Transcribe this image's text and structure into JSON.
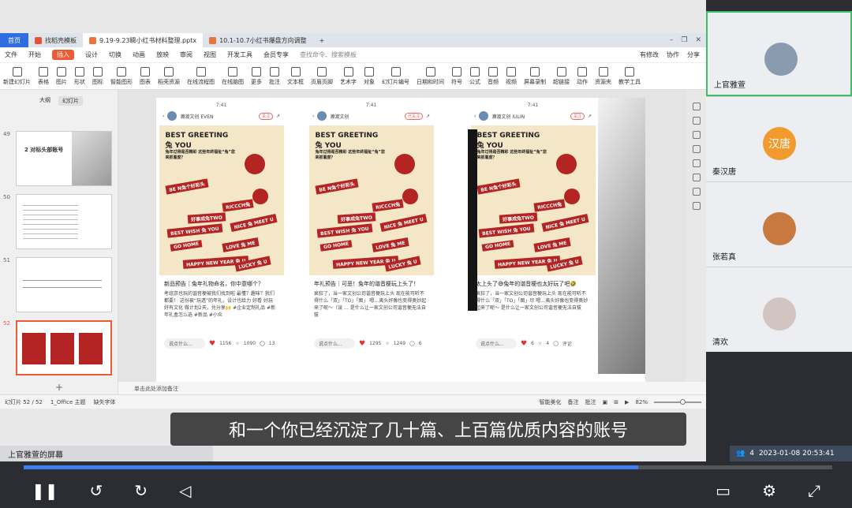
{
  "tabs": {
    "home": "首页",
    "items": [
      {
        "label": "找稻壳模板",
        "color": "#e4513a"
      },
      {
        "label": "9.19-9.23瞬小红书材料整理.pptx",
        "color": "#e9743c"
      },
      {
        "label": "10.1-10.7小红书爆盘方向调整",
        "color": "#e9743c"
      }
    ],
    "add": "+"
  },
  "menu": {
    "items": [
      "文件",
      "开始",
      "插入",
      "设计",
      "切换",
      "动画",
      "放映",
      "审阅",
      "视图",
      "开发工具",
      "会员专享"
    ],
    "selected": "插入",
    "search": "查找命令、搜索模板",
    "right": [
      "有修改",
      "协作",
      "分享"
    ]
  },
  "ribbon": [
    "新建幻灯片",
    "表格",
    "图片",
    "形状",
    "图标",
    "智能图形",
    "图表",
    "稻壳资源",
    "在线流程图",
    "在线脑图",
    "更多",
    "批注",
    "文本框",
    "页眉页脚",
    "艺术字",
    "对象",
    "幻灯片编号",
    "日期和时间",
    "符号",
    "公式",
    "音频",
    "视频",
    "屏幕录制",
    "超链接",
    "动作",
    "资源夹",
    "教学工具"
  ],
  "sidebar": {
    "tabs": [
      "大纲",
      "幻灯片"
    ],
    "slides": [
      {
        "num": "49",
        "title": "2 对标头部账号"
      },
      {
        "num": "50",
        "title": ""
      },
      {
        "num": "51",
        "title": ""
      },
      {
        "num": "52",
        "title": ""
      }
    ]
  },
  "phones": [
    {
      "time": "7:41",
      "account": "濑渡文创 EVEN",
      "follow": "关注",
      "caption": "新品预告｜兔年礼物命名，你中意哪个？",
      "body": "考组京也玩的谐音梗被我们找到啦 最懂？趣味？我们都要！ 这份被“玩透”的年礼，设计也给力 好看 好玩 好有文化 做计划2天，兑分享🙌 #企业定制礼品 #新年礼盒怎么选 #新品 #小众",
      "comment": "说点什么...",
      "likes": "1156",
      "stars": "1090",
      "comments": "13"
    },
    {
      "time": "7:41",
      "account": "濑渡文创",
      "follow": "已关注",
      "caption": "年礼预告｜可恶！兔年的谐音梗玩上头了！",
      "body": "疯狂了，当一家文创公司谐音梗玩上头 现在能可听不得什么「双」「TO」「图」 嗯…夷头好像也变得奥妙起来了呢～（误 … 是什么让一家文创公司谐音梗无法自拔",
      "comment": "说点什么...",
      "likes": "1295",
      "stars": "1249",
      "comments": "6"
    },
    {
      "time": "7:41",
      "account": "濑渡文创 IULIN",
      "follow": "关注",
      "caption": "太上头了😅兔年的谐音梗也太好玩了吧🤣",
      "body": "疯狂了，当一家文创公司谐音梗玩上头 现在能可听不得什么「双」「TO」「图」尽 嗯…夷头好像也变得奥妙起来了呢～ 是什么让一家文创公司谐音梗无法自拔",
      "comment": "说点什么...",
      "likes": "6",
      "stars": "4",
      "comments": "评论"
    }
  ],
  "poster": {
    "title1": "BEST GREETING",
    "title2": "兔 YOU",
    "subtitle": "兔年过得是否精彩 这些年终福祉“兔”您来抓着度？",
    "tags": [
      "BE N兔个好彩头",
      "RICCCH兔",
      "好事成兔TWO",
      "BEST WISH 兔 YOU",
      "NICE 兔 MEET U",
      "GO HOME",
      "LOVE 兔 ME",
      "HAPPY NEW YEAR 兔 U",
      "LUCKY 兔 U"
    ]
  },
  "notes": "单击此处添加备注",
  "status": {
    "slide": "幻灯片 52 / 52",
    "theme": "1_Office 主题",
    "font": "缺失字体",
    "smart": "智能美化",
    "notes": "备注",
    "comment": "批注",
    "zoom": "82%",
    "zoom_level": 0.6
  },
  "participants": [
    {
      "name": "上官雅萱",
      "color": "#8a9bb0",
      "speaking": true
    },
    {
      "name": "秦汉唐",
      "color": "#f39a2e",
      "initials": "汉唐",
      "speaking": false
    },
    {
      "name": "张若真",
      "color": "#c8793f",
      "speaking": false
    },
    {
      "name": "清欢",
      "color": "#d2c4c0",
      "speaking": false
    }
  ],
  "subtitle": "和一个你已经沉淀了几十篇、上百篇优质内容的账号",
  "owner": "上官雅萱的屏幕",
  "meeting": {
    "count": "4",
    "datetime": "2023-01-08 20:53:41"
  },
  "progress": 0.76
}
